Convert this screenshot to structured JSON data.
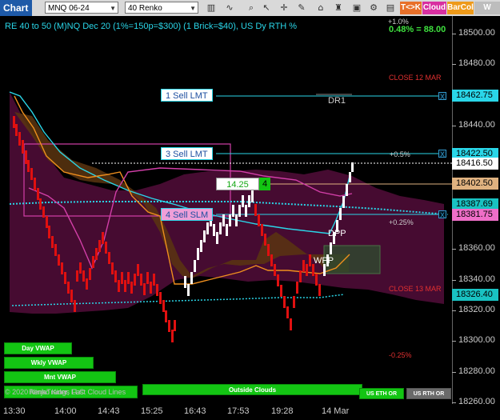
{
  "toolbar": {
    "title": "Chart",
    "instrument": "MNQ 06-24",
    "bar_type": "40 Renko",
    "buttons": [
      {
        "label": "T<>K",
        "bg": "#e8702a",
        "fg": "#ffffff"
      },
      {
        "label": "Cloud",
        "bg": "#d82fa0",
        "fg": "#ffffff"
      },
      {
        "label": "BarCol",
        "bg": "#ee9a1a",
        "fg": "#ffffff"
      },
      {
        "label": "W VWA",
        "bg": "#bdbdbd",
        "fg": "#ffffff"
      }
    ]
  },
  "header": {
    "info": "RE 40 to 50 (M)NQ Dec 20 (1%=150p=$300) (1 Brick=$40), US Dy RTH %",
    "pct_top": "+1.0%",
    "perf": "0.48% = 88.00"
  },
  "price_axis": {
    "ticks": [
      "18500.00",
      "18480.00",
      "18460.00",
      "18440.00",
      "18420.00",
      "18400.00",
      "18380.00",
      "18360.00",
      "18340.00",
      "18320.00",
      "18300.00",
      "18280.00",
      "18260.00"
    ],
    "labels": [
      {
        "text": "18462.75",
        "bg": "#2ad6e8",
        "fg": "#000000"
      },
      {
        "text": "18422.50",
        "bg": "#2ad6e8",
        "fg": "#000000"
      },
      {
        "text": "18416.50",
        "bg": "#ffffff",
        "fg": "#000000"
      },
      {
        "text": "18402.50",
        "bg": "#e0b280",
        "fg": "#000000"
      },
      {
        "text": "18387.69",
        "bg": "#19c2c2",
        "fg": "#000000"
      },
      {
        "text": "18381.75",
        "bg": "#ef6ec8",
        "fg": "#000000"
      },
      {
        "text": "18326.40",
        "bg": "#19c2c2",
        "fg": "#000000"
      }
    ]
  },
  "time_axis": {
    "labels": [
      "13:30",
      "14:00",
      "14:43",
      "15:25",
      "16:43",
      "17:53",
      "19:28",
      "14 Mar"
    ]
  },
  "orders": {
    "sell1": "1 Sell LMT",
    "sell3": "3 Sell LMT",
    "sell4": "4 Sell SLM",
    "x": "X"
  },
  "annotations": {
    "close12": "CLOSE 12 MAR",
    "close13": "CLOSE 13 MAR",
    "dr1": "DR1",
    "dpp": "DPP",
    "wpp": "WPP",
    "p05": "+0.5%",
    "p025": "+0.25%",
    "m025": "-0.25%",
    "price_box": "14.25",
    "qty_box": "4",
    "copyright": "© 2020 NinjaTrader, LLC",
    "cloud_lines": "Renko Kings Fast Cloud Lines"
  },
  "bottom_buttons": {
    "day_vwap": "Day VWAP",
    "wkly_vwap": "Wkly VWAP",
    "mnt_vwap": "Mnt VWAP",
    "outside_clouds": "Outside Clouds",
    "us_eth_or": "US ETH OR",
    "us_rth_or": "US RTH OR"
  },
  "colors": {
    "up_brick": "#ffffff",
    "down_brick": "#e01010",
    "cyan_line": "#2ad6e8",
    "orange_line": "#ef8f1e",
    "pink_line": "#d23fa8",
    "cloud_fill": "#5a0f3e",
    "brown_fill": "#5a3510",
    "green": "#13c513"
  }
}
